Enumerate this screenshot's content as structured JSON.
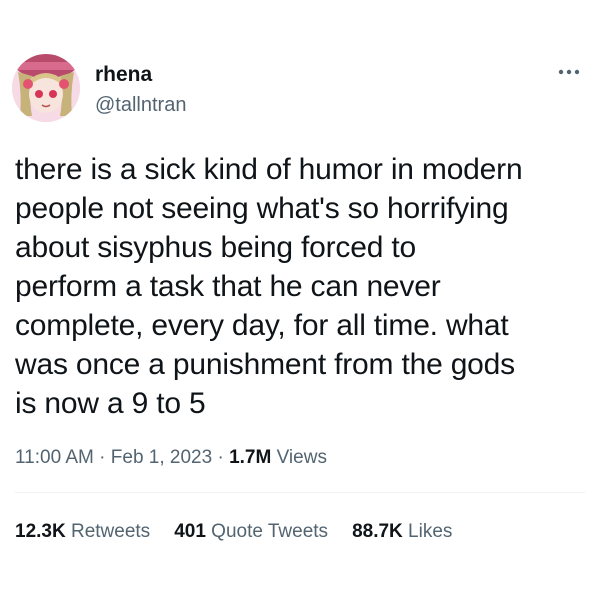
{
  "author": {
    "display_name": "rhena",
    "handle": "@tallntran"
  },
  "more_icon": "more-horizontal-icon",
  "tweet": {
    "text": "there is a sick kind of humor in modern\npeople not seeing what's so horrifying\nabout sisyphus being forced to\nperform a task that he can never\ncomplete, every day, for all time. what\nwas once a punishment from the gods\nis now a 9 to 5"
  },
  "meta": {
    "time": "11:00 AM",
    "separator": " · ",
    "date": "Feb 1, 2023",
    "views_count": "1.7M",
    "views_label": " Views"
  },
  "stats": {
    "retweets_count": "12.3K",
    "retweets_label": " Retweets",
    "quotes_count": "401",
    "quotes_label": " Quote Tweets",
    "likes_count": "88.7K",
    "likes_label": " Likes"
  },
  "colors": {
    "text_primary": "#0f1419",
    "text_secondary": "#536471",
    "divider": "#eff3f4"
  }
}
